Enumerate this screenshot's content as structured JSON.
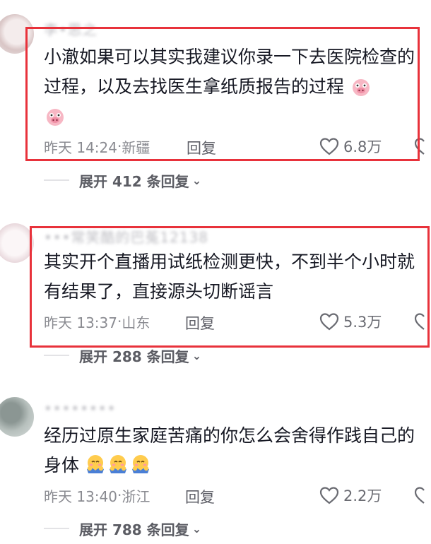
{
  "comments": [
    {
      "username": "李•思之",
      "text": "小澈如果可以其实我建议你录一下去医院检查的过程，以及去找医生拿纸质报告的过程",
      "trailing_emojis": [
        "pig-face-emoji",
        "pig-face-emoji"
      ],
      "time": "昨天 14:24",
      "location": "新疆",
      "reply_label": "回复",
      "likes": "6.8万",
      "expand_label": "展开 412 条回复"
    },
    {
      "username": "•••常笑酷的巴菟12138",
      "text": "其实开个直播用试纸检测更快，不到半个小时就有结果了，直接源头切断谣言",
      "time": "昨天 13:37",
      "location": "山东",
      "reply_label": "回复",
      "likes": "5.3万",
      "expand_label": "展开 288 条回复"
    },
    {
      "username": "••••••••",
      "text": "经历过原生家庭苦痛的你怎么会舍得作践自己的身体",
      "trailing_emojis": [
        "hug-emoji",
        "hug-emoji",
        "hug-emoji"
      ],
      "time": "昨天 13:40",
      "location": "浙江",
      "reply_label": "回复",
      "likes": "2.2万",
      "expand_label": "展开 788 条回复"
    }
  ],
  "colors": {
    "highlight_box": "#e8323b",
    "meta_text": "#8a8b91",
    "body_text": "#161823"
  }
}
